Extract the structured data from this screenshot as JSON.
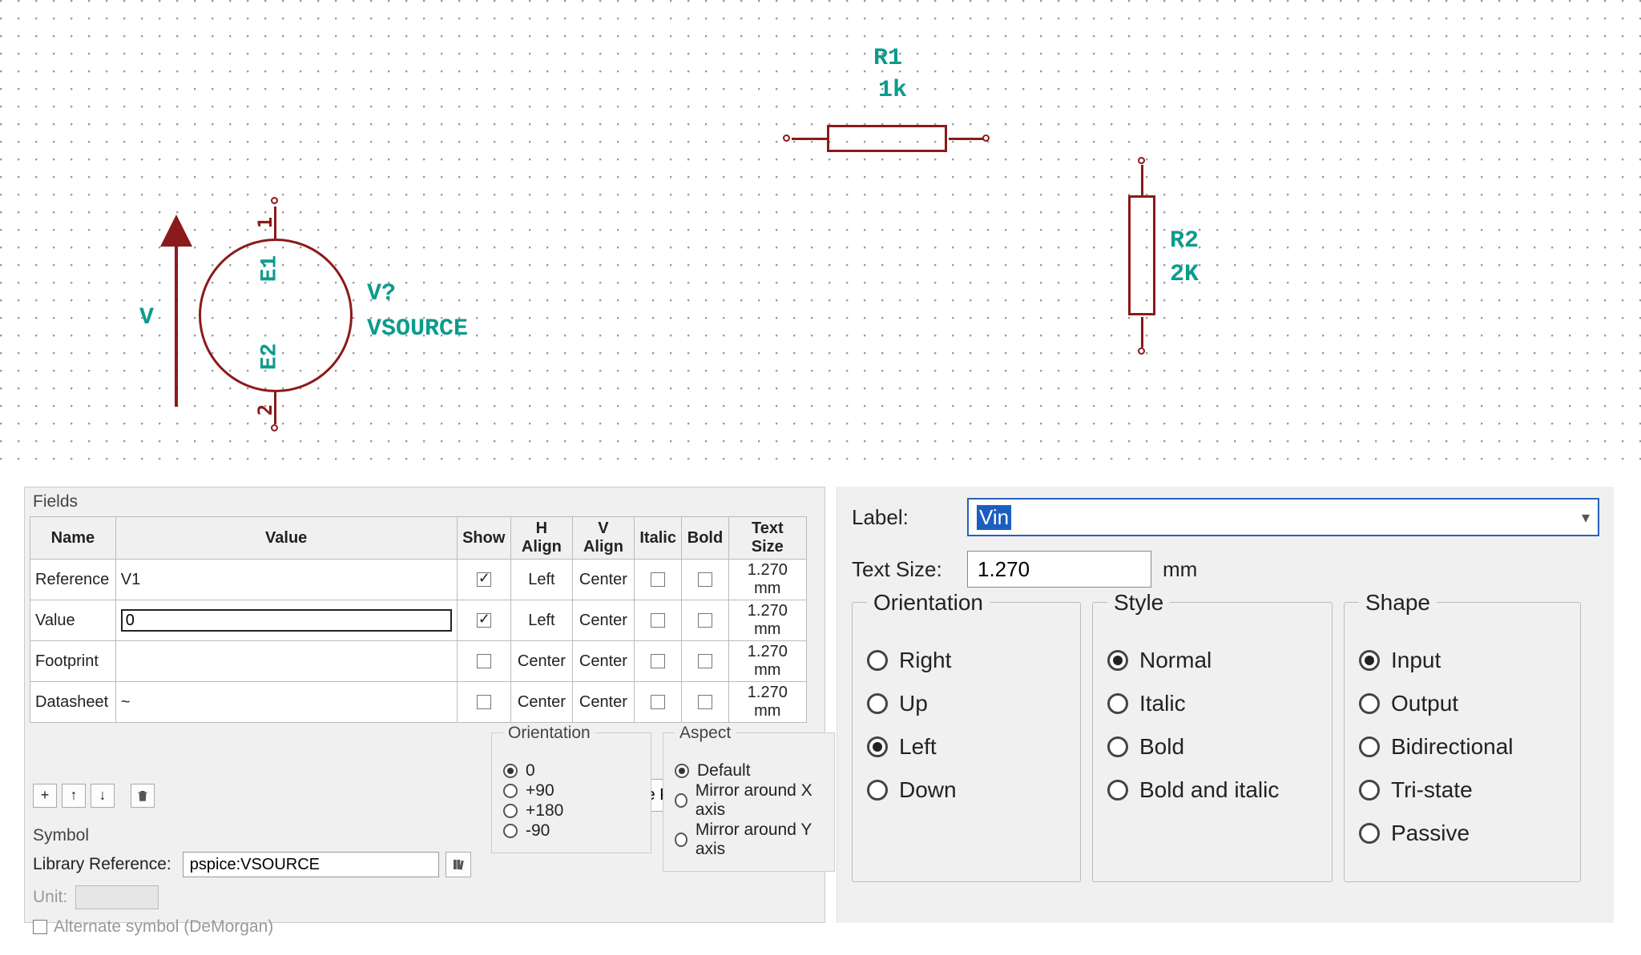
{
  "schematic": {
    "r1": {
      "ref": "R1",
      "val": "1k"
    },
    "r2": {
      "ref": "R2",
      "val": "2K"
    },
    "vsource": {
      "ref_q": "V?",
      "type": "VSOURCE",
      "e1": "E1",
      "e2": "E2",
      "v_axis": "V",
      "pin_top": "1",
      "pin_bot": "2"
    }
  },
  "fields_panel": {
    "title": "Fields",
    "headers": {
      "name": "Name",
      "value": "Value",
      "show": "Show",
      "halign": "H Align",
      "valign": "V Align",
      "italic": "Italic",
      "bold": "Bold",
      "tsize": "Text Size"
    },
    "rows": [
      {
        "name": "Reference",
        "value": "V1",
        "show": true,
        "halign": "Left",
        "valign": "Center",
        "italic": false,
        "bold": false,
        "tsize": "1.270 mm",
        "editing": false
      },
      {
        "name": "Value",
        "value": "0",
        "show": true,
        "halign": "Left",
        "valign": "Center",
        "italic": false,
        "bold": false,
        "tsize": "1.270 mm",
        "editing": true
      },
      {
        "name": "Footprint",
        "value": "",
        "show": false,
        "halign": "Center",
        "valign": "Center",
        "italic": false,
        "bold": false,
        "tsize": "1.270 mm",
        "editing": false
      },
      {
        "name": "Datasheet",
        "value": "~",
        "show": false,
        "halign": "Center",
        "valign": "Center",
        "italic": false,
        "bold": false,
        "tsize": "1.270 mm",
        "editing": false
      }
    ],
    "update_btn": "Update Fields from Library...",
    "symbol_title": "Symbol",
    "libref_label": "Library Reference:",
    "libref_value": "pspice:VSOURCE",
    "unit_label": "Unit:",
    "demorgan": "Alternate symbol (DeMorgan)",
    "orientation": {
      "title": "Orientation",
      "options": [
        "0",
        "+90",
        "+180",
        "-90"
      ],
      "selected": "0"
    },
    "aspect": {
      "title": "Aspect",
      "options": [
        "Default",
        "Mirror around X axis",
        "Mirror around Y axis"
      ],
      "selected": "Default"
    }
  },
  "label_panel": {
    "label_lab": "Label:",
    "label_value": "Vin",
    "text_size_lab": "Text Size:",
    "text_size_value": "1.270",
    "unit": "mm",
    "orientation": {
      "title": "Orientation",
      "options": [
        "Right",
        "Up",
        "Left",
        "Down"
      ],
      "selected": "Left"
    },
    "style": {
      "title": "Style",
      "options": [
        "Normal",
        "Italic",
        "Bold",
        "Bold and italic"
      ],
      "selected": "Normal"
    },
    "shape": {
      "title": "Shape",
      "options": [
        "Input",
        "Output",
        "Bidirectional",
        "Tri-state",
        "Passive"
      ],
      "selected": "Input"
    }
  }
}
